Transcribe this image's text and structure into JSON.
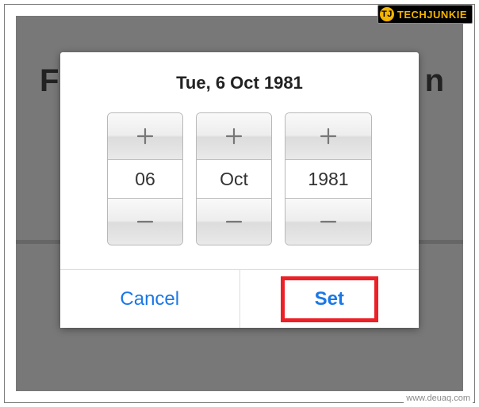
{
  "background": {
    "peek_left": "F",
    "peek_right": "n"
  },
  "modal": {
    "title": "Tue, 6 Oct 1981",
    "day": {
      "value": "06",
      "plus": "+",
      "minus": "−"
    },
    "month": {
      "value": "Oct",
      "plus": "+",
      "minus": "−"
    },
    "year": {
      "value": "1981",
      "plus": "+",
      "minus": "−"
    },
    "actions": {
      "cancel": "Cancel",
      "set": "Set"
    }
  },
  "watermarks": {
    "brand_logo": "TJ",
    "brand_name": "TECHJUNKIE",
    "source": "www.deuaq.com"
  }
}
